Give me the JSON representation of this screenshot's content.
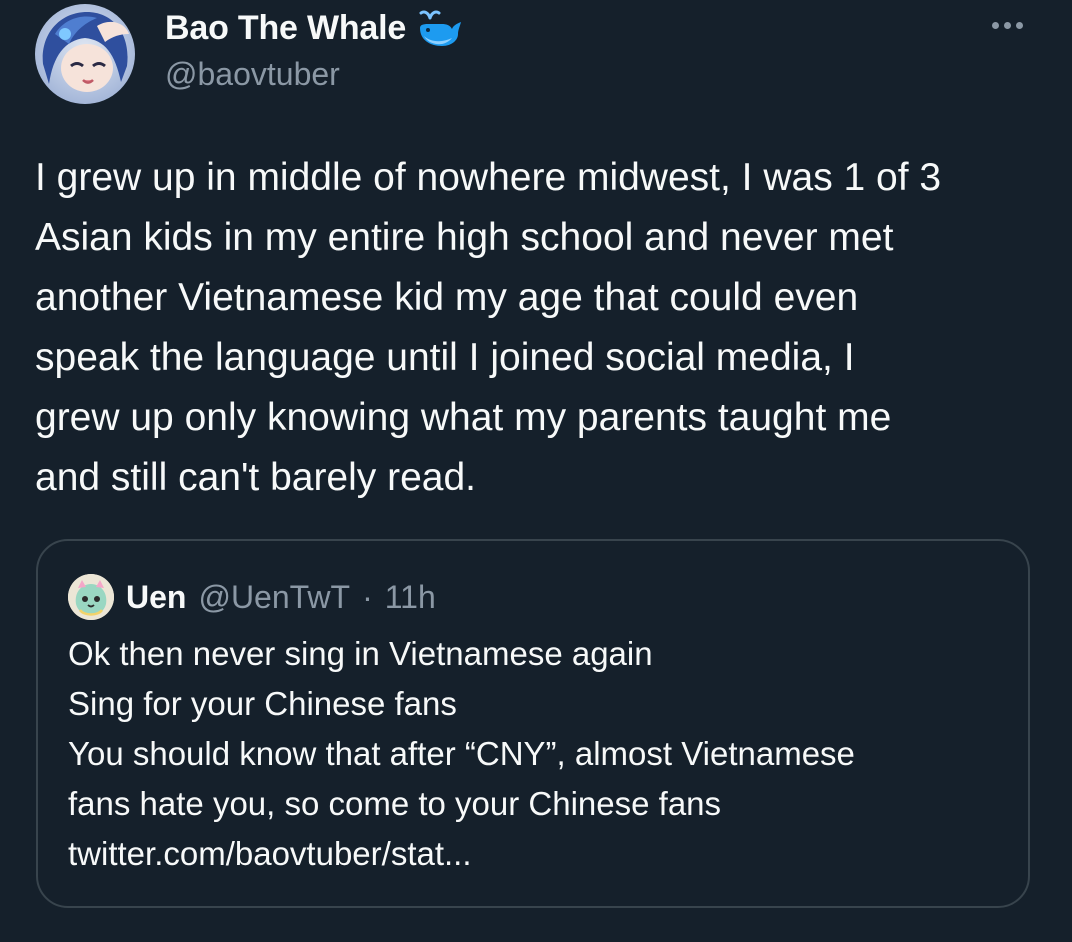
{
  "tweet": {
    "author": {
      "display_name": "Bao The Whale",
      "handle": "@baovtuber",
      "badge_icon": "whale-icon",
      "avatar": "avatar-image"
    },
    "more_icon": "ellipsis-icon",
    "text": "I grew up in middle of nowhere midwest, I was 1 of 3\nAsian kids in my entire high school and never met\nanother Vietnamese kid my age that could even\nspeak the language until I joined social media, I\ngrew up only knowing what my parents taught me\nand still can't barely read."
  },
  "quote": {
    "author": {
      "display_name": "Uen",
      "handle": "@UenTwT",
      "separator": "·",
      "time": "11h",
      "avatar": "avatar-image"
    },
    "text": "Ok then never sing in Vietnamese again\nSing for your Chinese fans\nYou should know that after “CNY”, almost Vietnamese\nfans hate you, so come to your Chinese fans\ntwitter.com/baovtuber/stat..."
  },
  "colors": {
    "background": "#15202b",
    "text_primary": "#f7f9f9",
    "text_secondary": "#8b98a5",
    "border": "#38444d",
    "badge": "#1d9bf0"
  }
}
